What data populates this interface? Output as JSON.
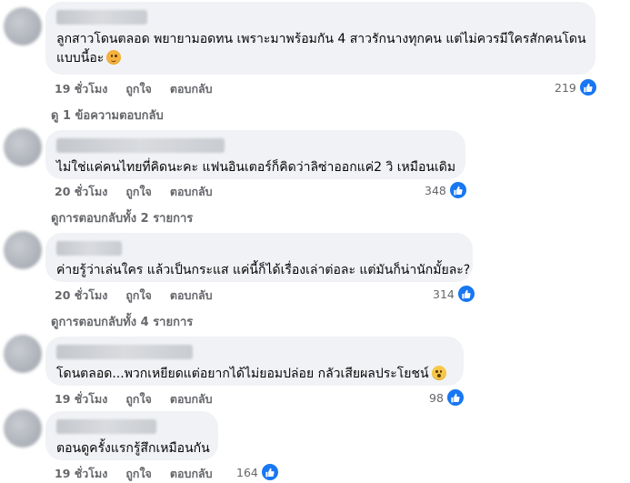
{
  "comments": [
    {
      "text_line1": "ลูกสาวโดนตลอด พยายามอดทน เพราะมาพร้อมกัน 4 สาวรักนางทุกคน แต่ไม่ควรมีใครสักคนโดน",
      "text_line2": "แบบนี้อะ",
      "emoji": "sad-face-emoji",
      "time": "19 ชั่วโมง",
      "like_label": "ถูกใจ",
      "reply_label": "ตอบกลับ",
      "reaction_count": "219",
      "replies_link": "ดู 1 ข้อความตอบกลับ"
    },
    {
      "text_line1": "ไม่ใช่แค่คนไทยที่คิดนะคะ แฟนอินเตอร์ก็คิดว่าลิซ่าออกแค่2 วิ เหมือนเดิม",
      "time": "20 ชั่วโมง",
      "like_label": "ถูกใจ",
      "reply_label": "ตอบกลับ",
      "reaction_count": "348",
      "replies_link": "ดูการตอบกลับทั้ง 2 รายการ"
    },
    {
      "text_line1": "ค่ายรู้ว่าเล่นใคร แล้วเป็นกระแส แค่นี้ก็ได้เรื่องเล่าต่อละ แต่มันก็น่านักมั้ยละ?",
      "time": "20 ชั่วโมง",
      "like_label": "ถูกใจ",
      "reply_label": "ตอบกลับ",
      "reaction_count": "314",
      "replies_link": "ดูการตอบกลับทั้ง 4 รายการ"
    },
    {
      "text_line1": "โดนตลอด...พวกเหยียดแต่อยากได้ไม่ยอมปล่อย กลัวเสียผลประโยชน์",
      "emoji": "shushing-face-emoji",
      "time": "19 ชั่วโมง",
      "like_label": "ถูกใจ",
      "reply_label": "ตอบกลับ",
      "reaction_count": "98"
    },
    {
      "text_line1": "ตอนดูครั้งแรกรู้สึกเหมือนกัน",
      "time": "19 ชั่วโมง",
      "like_label": "ถูกใจ",
      "reply_label": "ตอบกลับ",
      "reaction_count": "164"
    }
  ],
  "colors": {
    "bubble": "#f0f2f5",
    "secondary_text": "#65676b",
    "like_blue": "#1877f2"
  },
  "icons": {
    "reaction": "thumbs-up-icon"
  }
}
